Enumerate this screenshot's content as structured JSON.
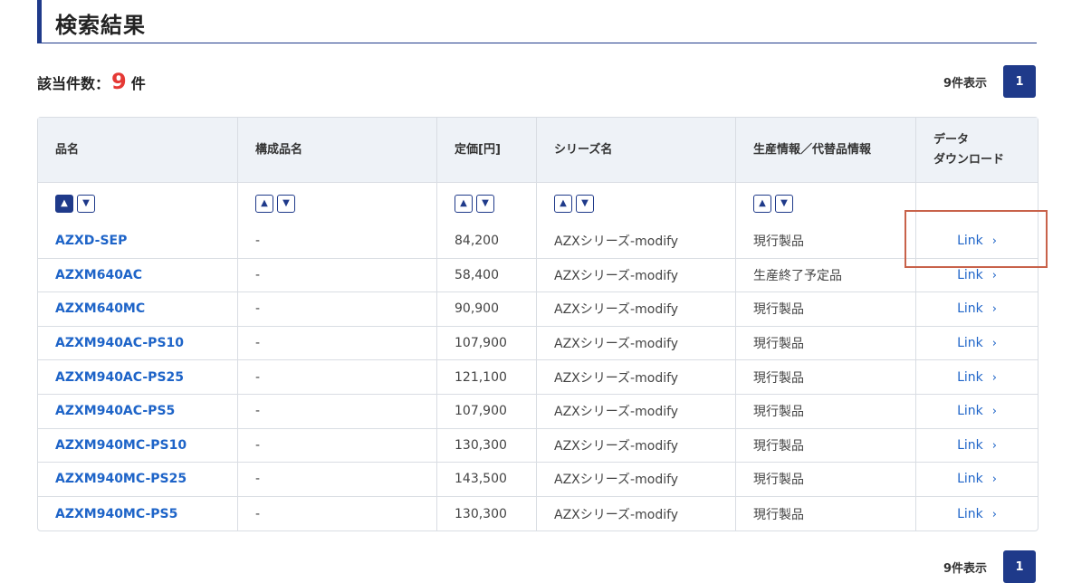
{
  "header": {
    "title": "検索結果"
  },
  "count": {
    "label": "該当件数：",
    "value": "9",
    "unit": "件"
  },
  "pager": {
    "display_text": "9件表示",
    "current_page": "1"
  },
  "table": {
    "columns": [
      "品名",
      "構成品名",
      "定価[円]",
      "シリーズ名",
      "生産情報／代替品情報",
      "データ\nダウンロード"
    ],
    "sort_up": "▲",
    "sort_down": "▼",
    "link_label": "Link",
    "link_chevron": "›",
    "rows": [
      {
        "name": "AZXD-SEP",
        "component": "-",
        "price": "84,200",
        "series": "AZXシリーズ-modify",
        "status": "現行製品"
      },
      {
        "name": "AZXM640AC",
        "component": "-",
        "price": "58,400",
        "series": "AZXシリーズ-modify",
        "status": "生産終了予定品"
      },
      {
        "name": "AZXM640MC",
        "component": "-",
        "price": "90,900",
        "series": "AZXシリーズ-modify",
        "status": "現行製品"
      },
      {
        "name": "AZXM940AC-PS10",
        "component": "-",
        "price": "107,900",
        "series": "AZXシリーズ-modify",
        "status": "現行製品"
      },
      {
        "name": "AZXM940AC-PS25",
        "component": "-",
        "price": "121,100",
        "series": "AZXシリーズ-modify",
        "status": "現行製品"
      },
      {
        "name": "AZXM940AC-PS5",
        "component": "-",
        "price": "107,900",
        "series": "AZXシリーズ-modify",
        "status": "現行製品"
      },
      {
        "name": "AZXM940MC-PS10",
        "component": "-",
        "price": "130,300",
        "series": "AZXシリーズ-modify",
        "status": "現行製品"
      },
      {
        "name": "AZXM940MC-PS25",
        "component": "-",
        "price": "143,500",
        "series": "AZXシリーズ-modify",
        "status": "現行製品"
      },
      {
        "name": "AZXM940MC-PS5",
        "component": "-",
        "price": "130,300",
        "series": "AZXシリーズ-modify",
        "status": "現行製品"
      }
    ]
  },
  "colors": {
    "accent": "#1f3a8a",
    "link": "#1e64c8",
    "count": "#e53935",
    "highlight": "#c8624a"
  }
}
